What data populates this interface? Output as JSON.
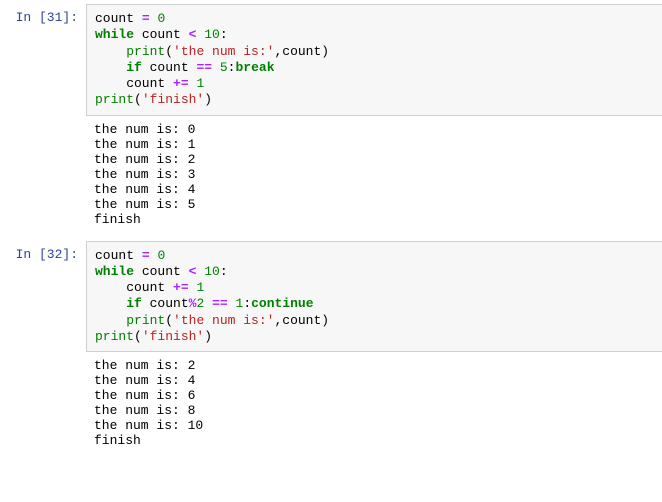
{
  "cells": [
    {
      "prompt_prefix": "In [",
      "exec_count": "31",
      "prompt_suffix": "]:",
      "code": [
        [
          {
            "t": "name",
            "v": "count "
          },
          {
            "t": "op",
            "v": "="
          },
          {
            "t": "name",
            "v": " "
          },
          {
            "t": "num",
            "v": "0"
          }
        ],
        [
          {
            "t": "kw",
            "v": "while"
          },
          {
            "t": "name",
            "v": " count "
          },
          {
            "t": "op",
            "v": "<"
          },
          {
            "t": "name",
            "v": " "
          },
          {
            "t": "num",
            "v": "10"
          },
          {
            "t": "punc",
            "v": ":"
          }
        ],
        [
          {
            "t": "name",
            "v": "    "
          },
          {
            "t": "builtin",
            "v": "print"
          },
          {
            "t": "punc",
            "v": "("
          },
          {
            "t": "str",
            "v": "'the num is:'"
          },
          {
            "t": "punc",
            "v": ",count)"
          }
        ],
        [
          {
            "t": "name",
            "v": "    "
          },
          {
            "t": "kw",
            "v": "if"
          },
          {
            "t": "name",
            "v": " count "
          },
          {
            "t": "op",
            "v": "=="
          },
          {
            "t": "name",
            "v": " "
          },
          {
            "t": "num",
            "v": "5"
          },
          {
            "t": "punc",
            "v": ":"
          },
          {
            "t": "kw",
            "v": "break"
          }
        ],
        [
          {
            "t": "name",
            "v": "    count "
          },
          {
            "t": "op",
            "v": "+="
          },
          {
            "t": "name",
            "v": " "
          },
          {
            "t": "num",
            "v": "1"
          }
        ],
        [
          {
            "t": "builtin",
            "v": "print"
          },
          {
            "t": "punc",
            "v": "("
          },
          {
            "t": "str",
            "v": "'finish'"
          },
          {
            "t": "punc",
            "v": ")"
          }
        ]
      ],
      "output": "the num is: 0\nthe num is: 1\nthe num is: 2\nthe num is: 3\nthe num is: 4\nthe num is: 5\nfinish"
    },
    {
      "prompt_prefix": "In [",
      "exec_count": "32",
      "prompt_suffix": "]:",
      "code": [
        [
          {
            "t": "name",
            "v": "count "
          },
          {
            "t": "op",
            "v": "="
          },
          {
            "t": "name",
            "v": " "
          },
          {
            "t": "num",
            "v": "0"
          }
        ],
        [
          {
            "t": "kw",
            "v": "while"
          },
          {
            "t": "name",
            "v": " count "
          },
          {
            "t": "op",
            "v": "<"
          },
          {
            "t": "name",
            "v": " "
          },
          {
            "t": "num",
            "v": "10"
          },
          {
            "t": "punc",
            "v": ":"
          }
        ],
        [
          {
            "t": "name",
            "v": "    count "
          },
          {
            "t": "op",
            "v": "+="
          },
          {
            "t": "name",
            "v": " "
          },
          {
            "t": "num",
            "v": "1"
          }
        ],
        [
          {
            "t": "name",
            "v": "    "
          },
          {
            "t": "kw",
            "v": "if"
          },
          {
            "t": "name",
            "v": " count"
          },
          {
            "t": "op",
            "v": "%"
          },
          {
            "t": "num",
            "v": "2"
          },
          {
            "t": "name",
            "v": " "
          },
          {
            "t": "op",
            "v": "=="
          },
          {
            "t": "name",
            "v": " "
          },
          {
            "t": "num",
            "v": "1"
          },
          {
            "t": "punc",
            "v": ":"
          },
          {
            "t": "kw",
            "v": "continue"
          }
        ],
        [
          {
            "t": "name",
            "v": "    "
          },
          {
            "t": "builtin",
            "v": "print"
          },
          {
            "t": "punc",
            "v": "("
          },
          {
            "t": "str",
            "v": "'the num is:'"
          },
          {
            "t": "punc",
            "v": ",count)"
          }
        ],
        [
          {
            "t": "builtin",
            "v": "print"
          },
          {
            "t": "punc",
            "v": "("
          },
          {
            "t": "str",
            "v": "'finish'"
          },
          {
            "t": "punc",
            "v": ")"
          }
        ]
      ],
      "output": "the num is: 2\nthe num is: 4\nthe num is: 6\nthe num is: 8\nthe num is: 10\nfinish"
    }
  ]
}
